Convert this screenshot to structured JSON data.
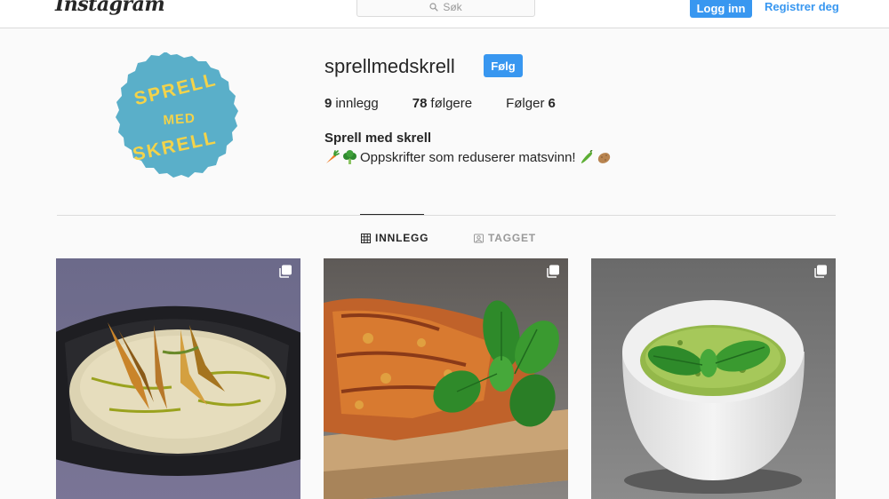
{
  "nav": {
    "logo": "Instagram",
    "search_placeholder": "Søk",
    "login": "Logg inn",
    "signup": "Registrer deg"
  },
  "profile": {
    "avatar_text": [
      "SPRELL",
      "MED",
      "SKRELL"
    ],
    "username": "sprellmedskrell",
    "follow": "Følg",
    "stats": {
      "posts_count": "9",
      "posts_label": "innlegg",
      "followers_count": "78",
      "followers_label": "følgere",
      "following_label": "Følger",
      "following_count": "6"
    },
    "full_name": "Sprell med skrell",
    "bio": "Oppskrifter som reduserer matsvinn!"
  },
  "tabs": {
    "posts": "INNLEGG",
    "tagged": "TAGGET"
  },
  "colors": {
    "accent": "#3897f0",
    "avatar_bg": "#5aafc9",
    "avatar_text": "#f3d34a"
  }
}
